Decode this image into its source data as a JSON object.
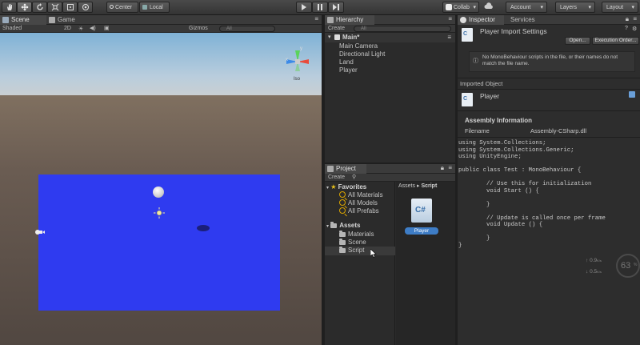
{
  "toolbar": {
    "pivot": "Center",
    "space": "Local",
    "collab": "Collab",
    "account": "Account",
    "layers": "Layers",
    "layout": "Layout"
  },
  "scene": {
    "tabs": [
      "Scene",
      "Game"
    ],
    "shading": "Shaded",
    "mode_2d": "2D",
    "gizmos": "Gizmos",
    "search_placeholder": "All",
    "gizmo_label": "Iso",
    "gizmo_axes": {
      "y": "y",
      "x": "x"
    },
    "ground_color": "#2f3bf0"
  },
  "hierarchy": {
    "tab": "Hierarchy",
    "create": "Create",
    "search_placeholder": "All",
    "scene_name": "Main*",
    "items": [
      "Main Camera",
      "Directional Light",
      "Land",
      "Player"
    ]
  },
  "project": {
    "tab": "Project",
    "create": "Create",
    "favorites_label": "Favorites",
    "favorites": [
      "All Materials",
      "All Models",
      "All Prefabs"
    ],
    "assets_label": "Assets",
    "folders": [
      "Materials",
      "Scene",
      "Script"
    ],
    "breadcrumb": {
      "root": "Assets",
      "separator": "▸",
      "current": "Script"
    },
    "asset_icon_text": "C#",
    "asset_name": "Player"
  },
  "inspector": {
    "tabs": [
      "Inspector",
      "Services"
    ],
    "title": "Player Import Settings",
    "open_button": "Open...",
    "exec_order_button": "Execution Order...",
    "warning": "No MonoBehaviour scripts in the file, or their names do not match the file name.",
    "imported_object_label": "Imported Object",
    "object_name": "Player",
    "assembly_header": "Assembly Information",
    "filename_label": "Filename",
    "filename_value": "Assembly-CSharp.dll",
    "code": "using System.Collections;\nusing System.Collections.Generic;\nusing UnityEngine;\n\npublic class Test : MonoBehaviour {\n\n        // Use this for initialization\n        void Start () {\n\n        }\n\n        // Update is called once per frame\n        void Update () {\n\n        }\n}"
  },
  "perf": {
    "stat1": "0.9",
    "stat1_unit": "K/s",
    "stat2": "0.5",
    "stat2_unit": "K/s",
    "percent": "63",
    "percent_unit": "%"
  }
}
